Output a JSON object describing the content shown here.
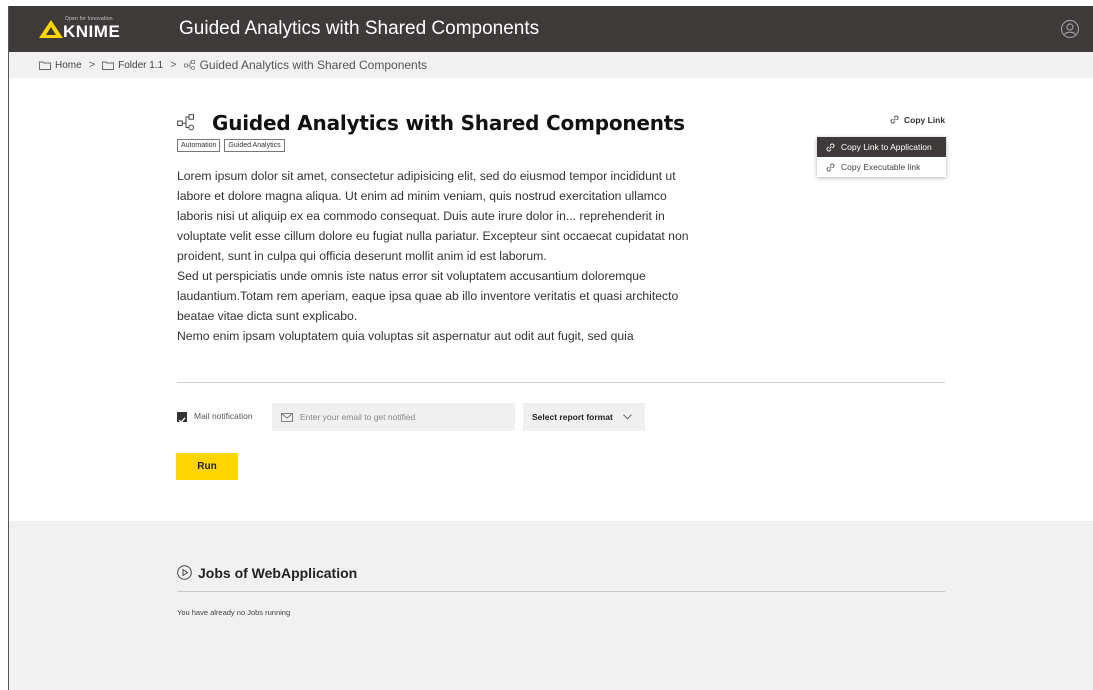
{
  "header": {
    "logo_tagline": "Open for Innovation",
    "logo_word": "KNIME",
    "title": "Guided Analytics with Shared Components",
    "user_icon": "user-circle-icon"
  },
  "breadcrumb": {
    "items": [
      {
        "label": "Home",
        "icon": "folder-icon"
      },
      {
        "label": "Folder 1.1",
        "icon": "folder-icon"
      }
    ],
    "separator": ">",
    "current": "Guided Analytics with Shared Components",
    "current_icon": "workflow-icon"
  },
  "main": {
    "title": "Guided Analytics with Shared Components",
    "tags": [
      "Automation",
      "Guided Analytics"
    ],
    "description": [
      "Lorem ipsum dolor sit amet, consectetur adipisicing elit, sed do eiusmod tempor incididunt ut labore et dolore magna aliqua. Ut enim ad minim veniam, quis nostrud exercitation ullamco laboris nisi ut aliquip ex ea commodo consequat. Duis aute irure dolor in... reprehenderit in voluptate velit esse cillum dolore eu fugiat nulla pariatur. Excepteur sint occaecat cupidatat non proident, sunt in culpa qui officia deserunt mollit anim id est laborum.",
      "Sed ut perspiciatis unde omnis iste natus error sit voluptatem accusantium doloremque laudantium.Totam rem aperiam, eaque ipsa quae ab illo inventore veritatis et quasi architecto beatae vitae dicta sunt explicabo.",
      "Nemo enim ipsam voluptatem quia voluptas sit aspernatur aut odit aut fugit, sed quia"
    ],
    "copy_link_label": "Copy Link",
    "copy_menu": [
      "Copy Link to Application",
      "Copy Executable link"
    ]
  },
  "form": {
    "mail_notification_label": "Mail notification",
    "mail_notification_checked": true,
    "email_placeholder": "Enter your email to get notified",
    "report_format_label": "Select report format",
    "run_label": "Run"
  },
  "jobs": {
    "title": "Jobs of WebApplication",
    "empty_message": "You have already no Jobs running"
  },
  "colors": {
    "header_bg": "#3e3a39",
    "accent_yellow": "#ffd500",
    "logo_yellow": "#fdd800",
    "section_bg": "#f1f1f1"
  }
}
